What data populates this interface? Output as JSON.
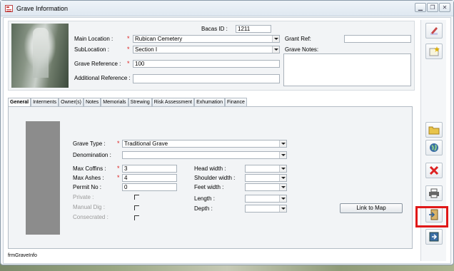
{
  "window": {
    "title": "Grave Information"
  },
  "header": {
    "bacas_id_label": "Bacas ID :",
    "bacas_id_value": "1211",
    "main_location_label": "Main Location :",
    "main_location_value": "Rubican Cemetery",
    "sublocation_label": "SubLocation :",
    "sublocation_value": "Section I",
    "grave_reference_label": "Grave Reference :",
    "grave_reference_value": "100",
    "additional_reference_label": "Additional Reference :",
    "additional_reference_value": "",
    "grant_ref_label": "Grant Ref:",
    "grant_ref_value": "",
    "grave_notes_label": "Grave Notes:",
    "required_mark": "*"
  },
  "tabs": [
    {
      "label": "General"
    },
    {
      "label": "Interments"
    },
    {
      "label": "Owner(s)"
    },
    {
      "label": "Notes"
    },
    {
      "label": "Memorials"
    },
    {
      "label": "Strewing"
    },
    {
      "label": "Risk Assessment"
    },
    {
      "label": "Exhumation"
    },
    {
      "label": "Finance"
    }
  ],
  "general": {
    "grave_type_label": "Grave Type :",
    "grave_type_value": "Traditional Grave",
    "denomination_label": "Denomination :",
    "denomination_value": "",
    "max_coffins_label": "Max Coffins :",
    "max_coffins_value": "3",
    "max_ashes_label": "Max Ashes :",
    "max_ashes_value": "4",
    "permit_no_label": "Permit No :",
    "permit_no_value": "0",
    "private_label": "Private :",
    "manual_dig_label": "Manual Dig :",
    "consecrated_label": "Consecrated :",
    "head_width_label": "Head width :",
    "shoulder_width_label": "Shoulder width :",
    "feet_width_label": "Feet width :",
    "length_label": "Length :",
    "depth_label": "Depth :",
    "link_to_map_label": "Link to Map"
  },
  "footer": {
    "form_name": "frmGraveInfo"
  },
  "toolbar": {
    "icons": [
      "edit-icon",
      "new-record-icon",
      "open-folder-icon",
      "globe-icon",
      "delete-icon",
      "print-icon",
      "exit-door-icon",
      "close-form-icon"
    ]
  },
  "colors": {
    "required": "#d22222",
    "highlight": "#e01818",
    "accent": "#3a6ea5"
  }
}
